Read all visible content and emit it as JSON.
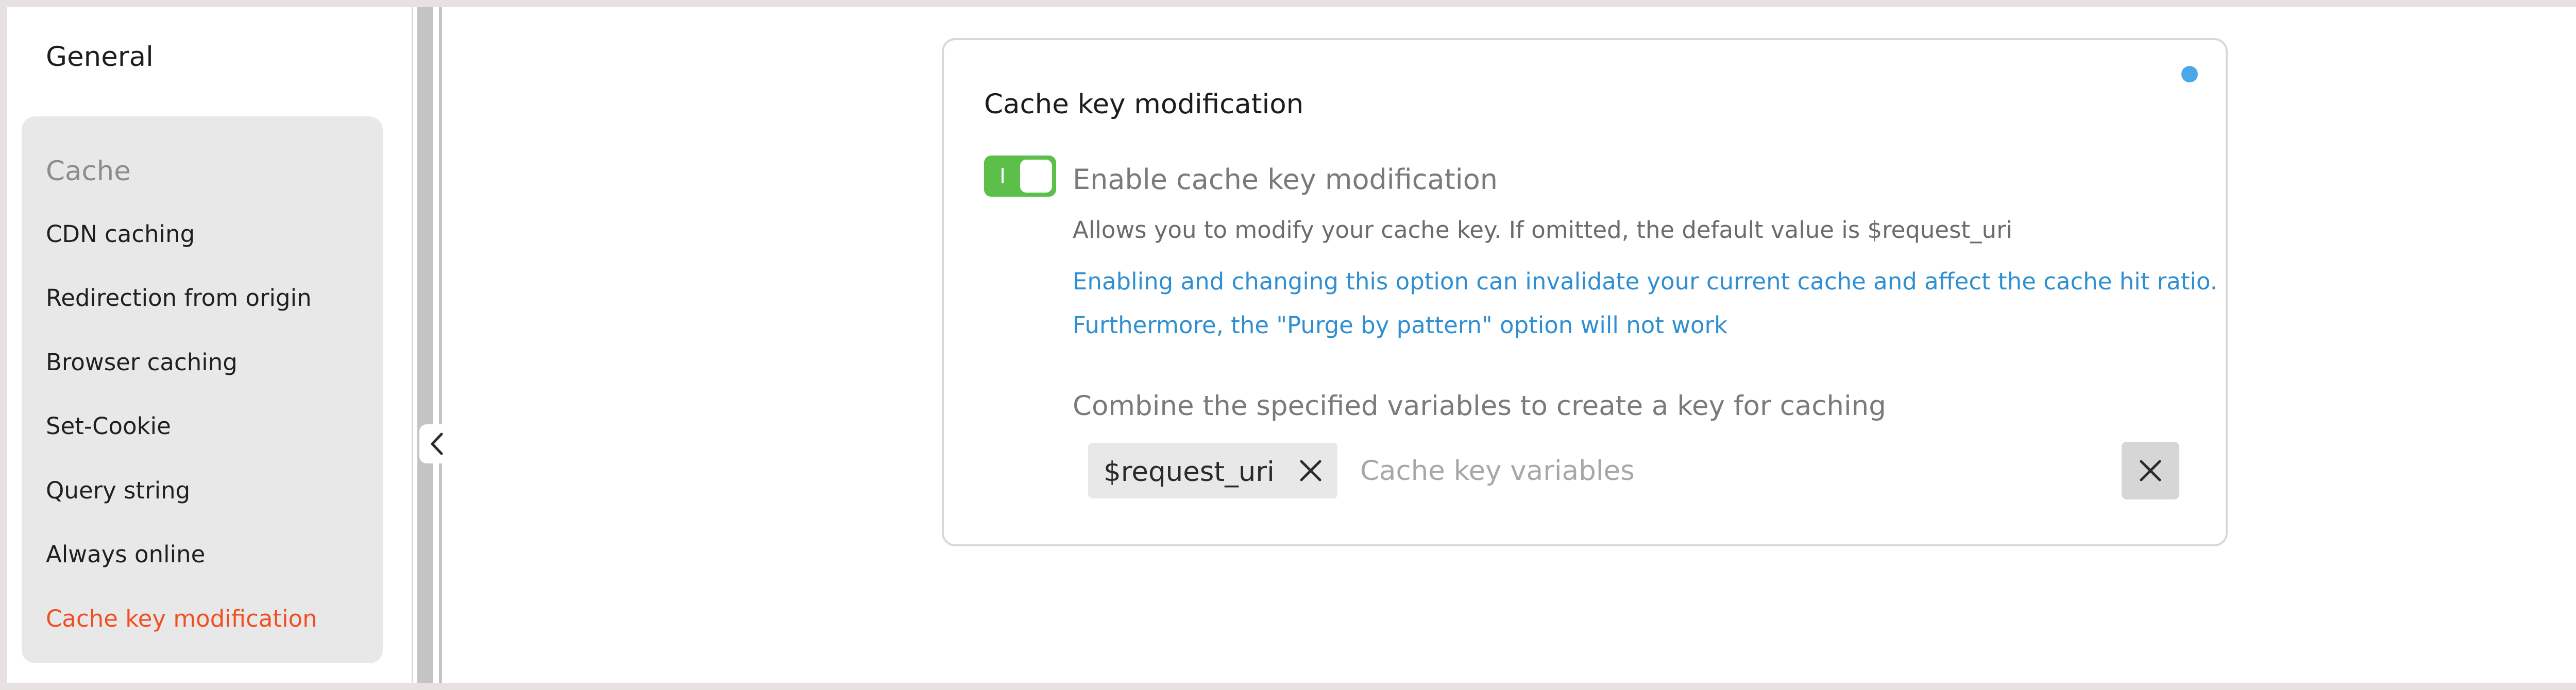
{
  "sidebar": {
    "title": "General",
    "group_header": "Cache",
    "items": [
      {
        "label": "CDN caching"
      },
      {
        "label": "Redirection from origin"
      },
      {
        "label": "Browser caching"
      },
      {
        "label": "Set-Cookie"
      },
      {
        "label": "Query string"
      },
      {
        "label": "Always online"
      },
      {
        "label": "Cache key modification"
      }
    ],
    "active_item": "Cache key modification"
  },
  "card": {
    "title": "Cache key modification",
    "toggle": {
      "enabled": true,
      "label": "Enable cache key modification"
    },
    "description": "Allows you to modify your cache key. If omitted, the default value is $request_uri",
    "warning_line1": "Enabling and changing this option can invalidate your current cache and affect the cache hit ratio.",
    "warning_line2": "Furthermore, the \"Purge by pattern\" option will not work",
    "combine_label": "Combine the specified variables to create a key for caching",
    "tags": [
      {
        "label": "$request_uri"
      }
    ],
    "input_placeholder": "Cache key variables"
  },
  "colors": {
    "accent_active": "#f04e23",
    "toggle_on": "#5cbf4a",
    "warning_text": "#2f8fd0",
    "status_dot": "#4aa8e8"
  },
  "icons": {
    "collapse": "chevron-left-icon",
    "tag_remove": "close-icon",
    "clear": "close-icon"
  }
}
